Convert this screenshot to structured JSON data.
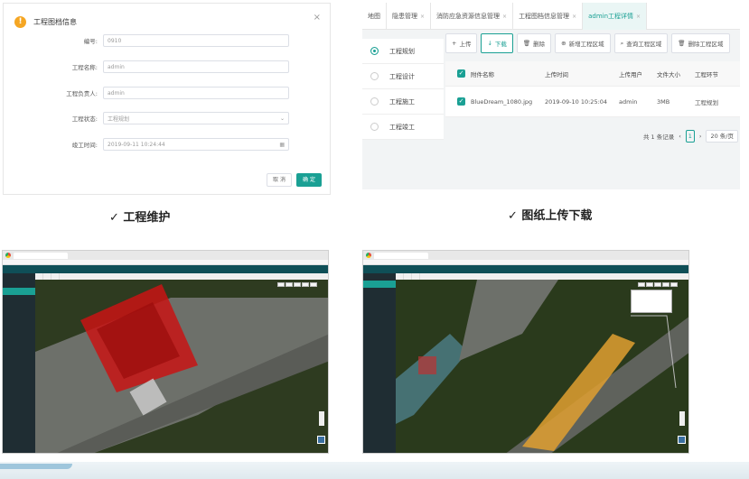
{
  "dialog": {
    "title": "工程图档信息",
    "fields": [
      {
        "label": "编号:",
        "value": "0910"
      },
      {
        "label": "工程名称:",
        "value": "admin"
      },
      {
        "label": "工程负责人:",
        "value": "admin"
      },
      {
        "label": "工程状态:",
        "value": "工程规划"
      },
      {
        "label": "竣工时间:",
        "value": "2019-09-11 10:24:44"
      }
    ],
    "cancel_label": "取 消",
    "ok_label": "确 定"
  },
  "file_manager": {
    "tabs": [
      {
        "label": "地图",
        "closable": false
      },
      {
        "label": "隐患管理",
        "closable": true
      },
      {
        "label": "消防应急资源信息管理",
        "closable": true
      },
      {
        "label": "工程图档信息管理",
        "closable": true
      },
      {
        "label": "admin工程详情",
        "closable": true
      }
    ],
    "stages": [
      "工程规划",
      "工程设计",
      "工程施工",
      "工程竣工"
    ],
    "toolbar": [
      "上传",
      "下载",
      "删除",
      "新增工程区域",
      "查询工程区域",
      "删除工程区域"
    ],
    "columns": [
      "附件名称",
      "上传时间",
      "上传用户",
      "文件大小",
      "工程环节"
    ],
    "rows": [
      [
        "BlueDream_1080.jpg",
        "2019-09-10 10:25:04",
        "admin",
        "3MB",
        "工程规划"
      ]
    ],
    "pager": {
      "total": "共 1 条记录",
      "page": "1",
      "page_size": "20 条/页"
    }
  },
  "captions": {
    "left": "✓ 工程维护",
    "right": "✓ 图纸上传下载"
  },
  "colors": {
    "accent": "#1aa094",
    "warn": "#f5a623",
    "area_red": "#c81414",
    "area_orange": "#e0a030"
  }
}
